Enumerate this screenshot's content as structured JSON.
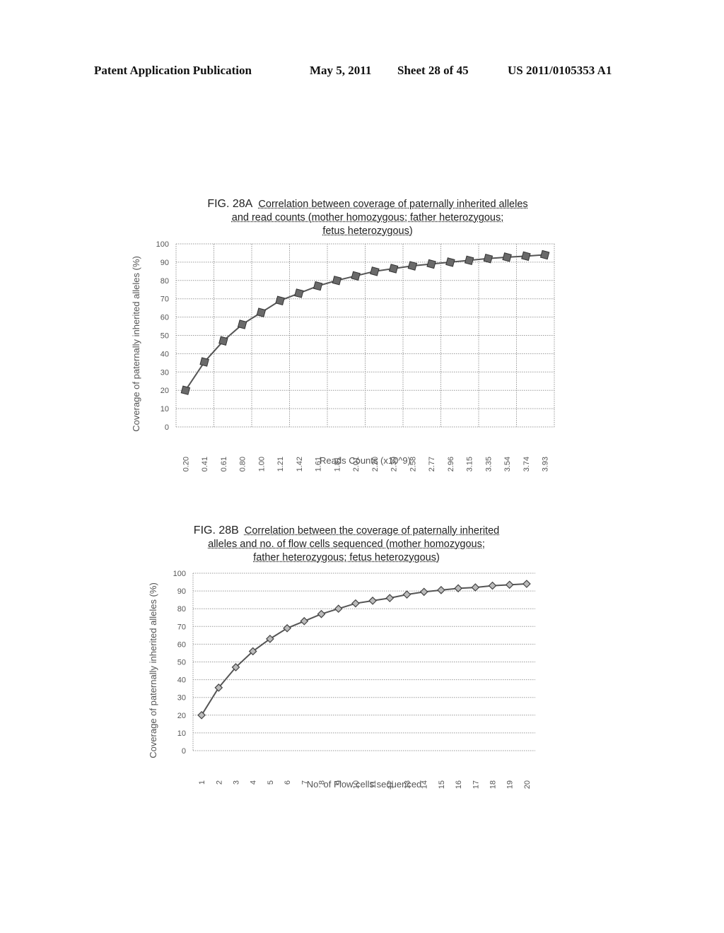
{
  "header": {
    "publication": "Patent Application Publication",
    "date": "May 5, 2011",
    "sheet": "Sheet 28 of 45",
    "number": "US 2011/0105353 A1"
  },
  "chart_data": [
    {
      "type": "line",
      "fig_label": "FIG. 28A",
      "title_lines": [
        "Correlation between coverage of paternally inherited alleles",
        "and read counts (mother homozygous; father heterozygous;",
        "fetus heterozygous)"
      ],
      "xlabel": "Reads Counts (x10^9)",
      "ylabel": "Coverage of paternally inherited alleles (%)",
      "ylim": [
        0,
        100
      ],
      "yticks": [
        0,
        10,
        20,
        30,
        40,
        50,
        60,
        70,
        80,
        90,
        100
      ],
      "grid": "both",
      "marker": "square",
      "categories": [
        "0.20",
        "0.41",
        "0.61",
        "0.80",
        "1.00",
        "1.21",
        "1.42",
        "1.61",
        "1.81",
        "2.01",
        "2.20",
        "2.39",
        "2.58",
        "2.77",
        "2.96",
        "3.15",
        "3.35",
        "3.54",
        "3.74",
        "3.93"
      ],
      "series": [
        {
          "name": "Coverage",
          "values": [
            20,
            35.5,
            47,
            56,
            62.5,
            69,
            73,
            77,
            80,
            82.5,
            85,
            86.5,
            88,
            89,
            90,
            91,
            92,
            92.7,
            93.3,
            94
          ]
        }
      ]
    },
    {
      "type": "line",
      "fig_label": "FIG. 28B",
      "title_lines": [
        "Correlation between the coverage of paternally inherited",
        "alleles and no. of flow cells sequenced (mother homozygous;",
        "father heterozygous; fetus heterozygous)"
      ],
      "xlabel": "No. of Flow cells sequenced",
      "ylabel": "Coverage of paternally inherited alleles (%)",
      "ylim": [
        0,
        100
      ],
      "yticks": [
        0,
        10,
        20,
        30,
        40,
        50,
        60,
        70,
        80,
        90,
        100
      ],
      "grid": "horizontal",
      "marker": "diamond",
      "categories": [
        "1",
        "2",
        "3",
        "4",
        "5",
        "6",
        "7",
        "8",
        "9",
        "10",
        "11",
        "12",
        "13",
        "14",
        "15",
        "16",
        "17",
        "18",
        "19",
        "20"
      ],
      "series": [
        {
          "name": "Coverage",
          "values": [
            20,
            35.5,
            47,
            56,
            63,
            69,
            73,
            77,
            80,
            83,
            84.5,
            86,
            88,
            89.5,
            90.5,
            91.5,
            92,
            93,
            93.5,
            94
          ]
        }
      ]
    }
  ]
}
